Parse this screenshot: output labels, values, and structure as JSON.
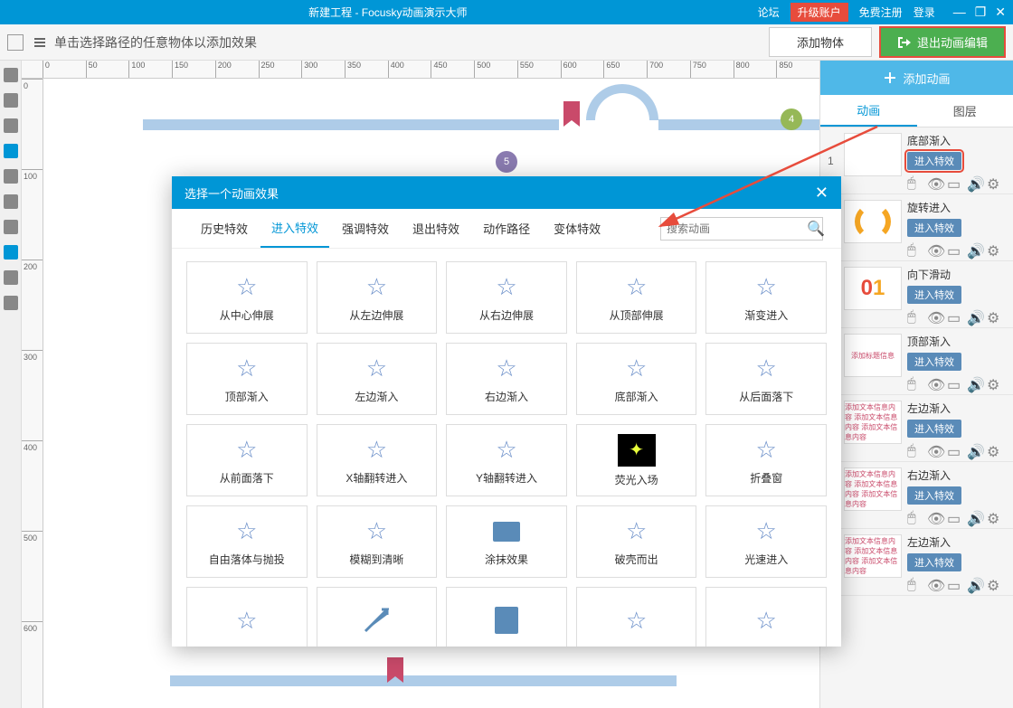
{
  "titlebar": {
    "title": "新建工程 - Focusky动画演示大师",
    "forum": "论坛",
    "upgrade": "升级账户",
    "register": "免费注册",
    "login": "登录"
  },
  "toolbar": {
    "hint": "单击选择路径的任意物体以添加效果",
    "add_object": "添加物体",
    "exit_edit": "退出动画编辑"
  },
  "ruler_h": [
    "0",
    "50",
    "100",
    "150",
    "200",
    "250",
    "300",
    "350",
    "400",
    "450",
    "500",
    "550",
    "600",
    "650",
    "700",
    "750",
    "800",
    "850"
  ],
  "ruler_v": [
    "0",
    "100",
    "200",
    "300",
    "400",
    "500",
    "600"
  ],
  "right_panel": {
    "add_anim": "添加动画",
    "tab_anim": "动画",
    "tab_layer": "图层",
    "items": [
      {
        "title": "底部渐入",
        "badge": "进入特效"
      },
      {
        "title": "旋转进入",
        "badge": "进入特效"
      },
      {
        "title": "向下滑动",
        "badge": "进入特效"
      },
      {
        "title": "顶部渐入",
        "badge": "进入特效",
        "thumb_text": "添加标题信息"
      },
      {
        "title": "左边渐入",
        "badge": "进入特效",
        "thumb_text": "添加文本信息内容 添加文本信息内容 添加文本信息内容"
      },
      {
        "title": "右边渐入",
        "badge": "进入特效",
        "thumb_text": "添加文本信息内容 添加文本信息内容 添加文本信息内容"
      },
      {
        "title": "左边渐入",
        "badge": "进入特效",
        "thumb_text": "添加文本信息内容 添加文本信息内容 添加文本信息内容"
      }
    ]
  },
  "modal": {
    "title": "选择一个动画效果",
    "tabs": [
      "历史特效",
      "进入特效",
      "强调特效",
      "退出特效",
      "动作路径",
      "变体特效"
    ],
    "active_tab": 1,
    "search_placeholder": "搜索动画",
    "effects": [
      "从中心伸展",
      "从左边伸展",
      "从右边伸展",
      "从顶部伸展",
      "渐变进入",
      "顶部渐入",
      "左边渐入",
      "右边渐入",
      "底部渐入",
      "从后面落下",
      "从前面落下",
      "X轴翻转进入",
      "Y轴翻转进入",
      "荧光入场",
      "折叠窗",
      "自由落体与抛投",
      "模糊到清晰",
      "涂抹效果",
      "破壳而出",
      "光速进入",
      "",
      "",
      "",
      "",
      ""
    ]
  },
  "canvas": {
    "dot4": "4",
    "dot5": "5"
  }
}
